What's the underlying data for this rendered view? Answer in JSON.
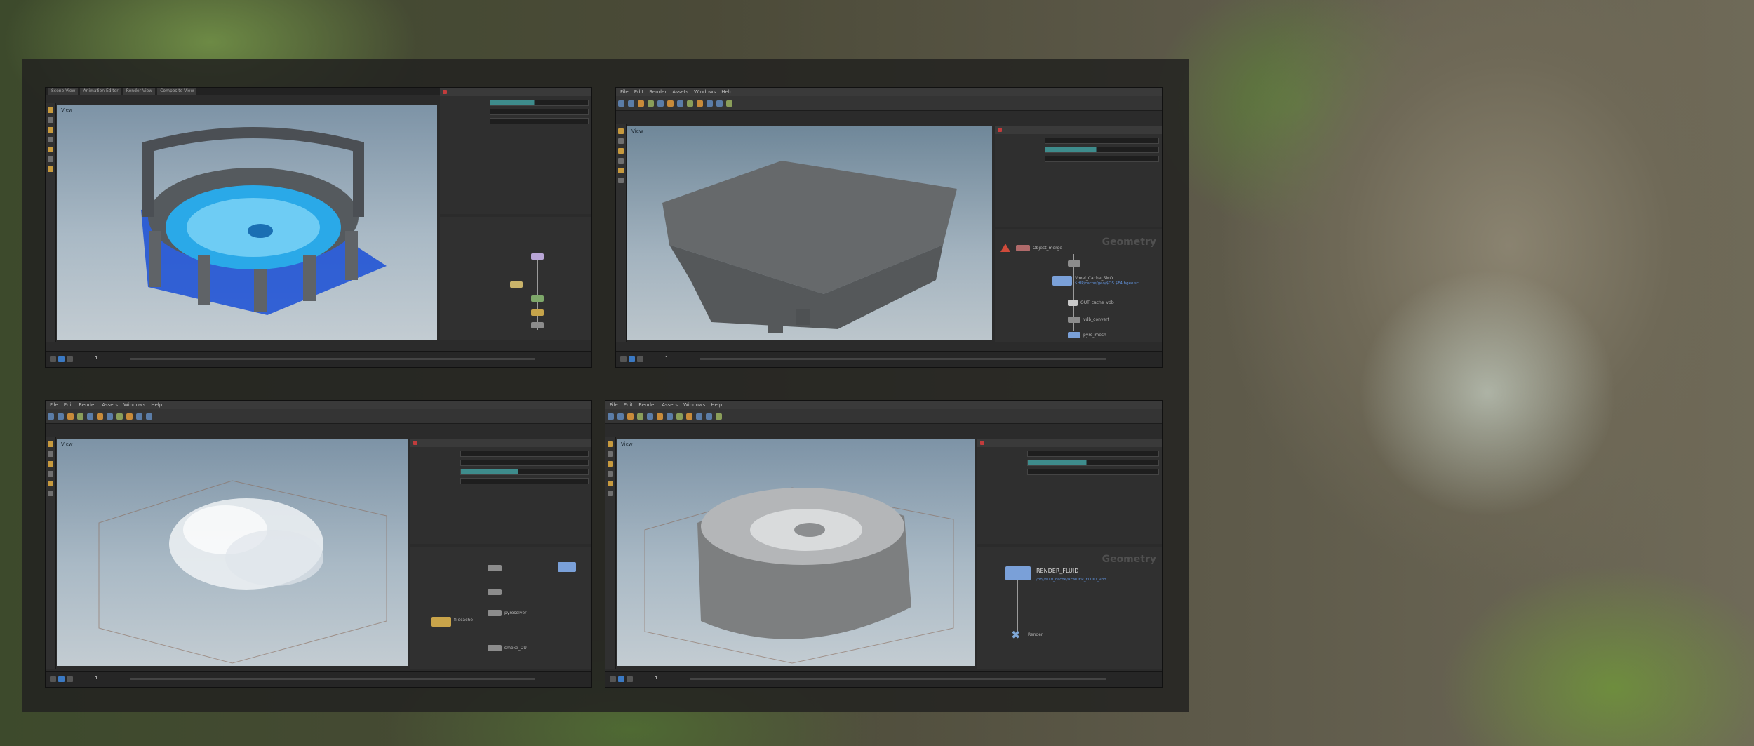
{
  "viewport": {
    "label": "View"
  },
  "menu": {
    "items": [
      "File",
      "Edit",
      "Render",
      "Assets",
      "Windows",
      "Help"
    ]
  },
  "windows": [
    {
      "id": "top-left",
      "frame": "1",
      "net_title": "",
      "nodes": []
    },
    {
      "id": "top-right",
      "frame": "1",
      "net_title": "Geometry",
      "nodes": [
        "Object_merge",
        "Voxel_Cache_SMO",
        "OUT_cache_vdb",
        "vdb_convert",
        "pyro_mesh"
      ],
      "sub": "$HIP/cache/geo/$OS.$F4.bgeo.sc"
    },
    {
      "id": "bottom-left",
      "frame": "1",
      "net_title": "",
      "nodes": [
        "filecache",
        "pyrosolver",
        "smoke_OUT"
      ]
    },
    {
      "id": "bottom-right",
      "frame": "1",
      "net_title": "Geometry",
      "nodes": [
        "RENDER_FLUID",
        "Render"
      ],
      "sub": "/obj/fluid_cache/RENDER_FLUID_vdb"
    }
  ],
  "colors": {
    "accent": "#3b79c3",
    "bar": "#3e8c8c",
    "warn": "#d04a3a",
    "fluid": "#2aa9e8"
  }
}
